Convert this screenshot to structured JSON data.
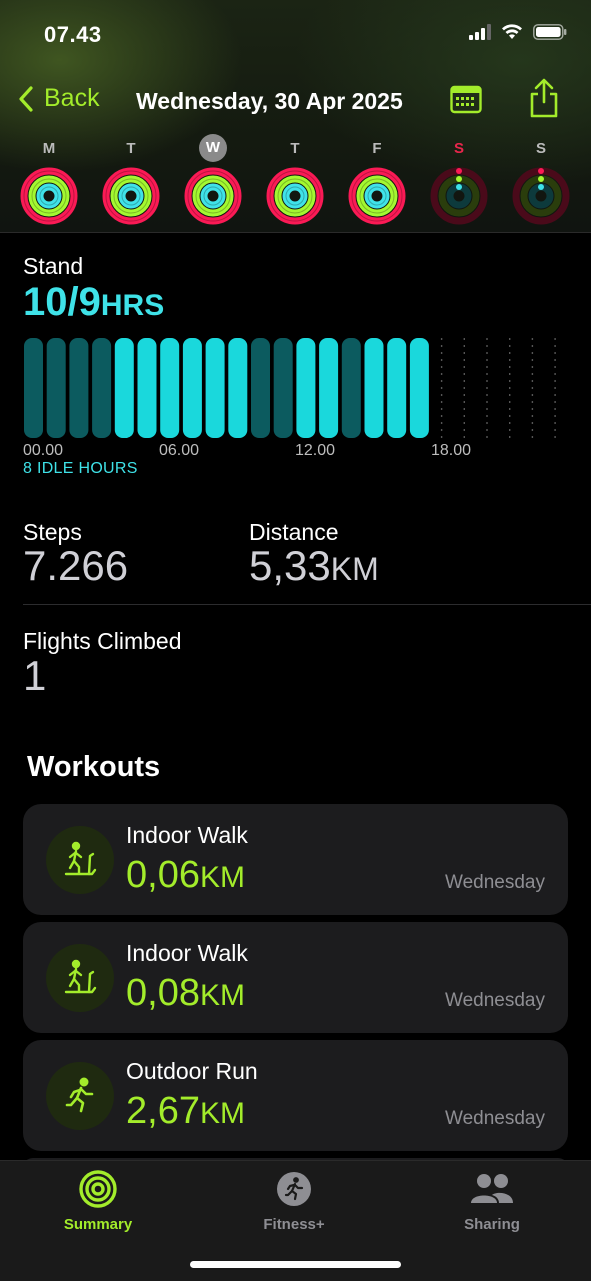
{
  "status_bar": {
    "time": "07.43"
  },
  "nav": {
    "back_label": "Back",
    "title": "Wednesday, 30 Apr 2025",
    "calendar_icon": "calendar-icon",
    "share_icon": "share-icon"
  },
  "week": {
    "days": [
      {
        "letter": "M",
        "state": "closed"
      },
      {
        "letter": "T",
        "state": "closed"
      },
      {
        "letter": "W",
        "state": "closed",
        "selected": true
      },
      {
        "letter": "T",
        "state": "closed"
      },
      {
        "letter": "F",
        "state": "closed"
      },
      {
        "letter": "S",
        "state": "empty"
      },
      {
        "letter": "S",
        "state": "empty"
      }
    ]
  },
  "stand": {
    "label": "Stand",
    "value": "10/9",
    "unit": "HRS",
    "idle_text": "8 IDLE HOURS",
    "ticks": [
      "00.00",
      "06.00",
      "12.00",
      "18.00"
    ],
    "hours": [
      0,
      0,
      0,
      0,
      1,
      1,
      1,
      1,
      1,
      1,
      0,
      0,
      1,
      1,
      0,
      1,
      1,
      1
    ]
  },
  "steps": {
    "label": "Steps",
    "value": "7.266"
  },
  "distance": {
    "label": "Distance",
    "value": "5,33",
    "unit": "KM"
  },
  "flights": {
    "label": "Flights Climbed",
    "value": "1"
  },
  "workouts": {
    "title": "Workouts",
    "items": [
      {
        "name": "Indoor Walk",
        "value": "0,06",
        "unit": "KM",
        "day": "Wednesday",
        "icon": "treadmill-walk-icon"
      },
      {
        "name": "Indoor Walk",
        "value": "0,08",
        "unit": "KM",
        "day": "Wednesday",
        "icon": "treadmill-walk-icon"
      },
      {
        "name": "Outdoor Run",
        "value": "2,67",
        "unit": "KM",
        "day": "Wednesday",
        "icon": "running-icon"
      }
    ]
  },
  "tabbar": {
    "summary": "Summary",
    "fitness": "Fitness+",
    "sharing": "Sharing"
  },
  "colors": {
    "accent": "#a3ec2b",
    "stand": "#3fe2e8",
    "move": "#fa1a55",
    "exercise": "#a3f830"
  }
}
